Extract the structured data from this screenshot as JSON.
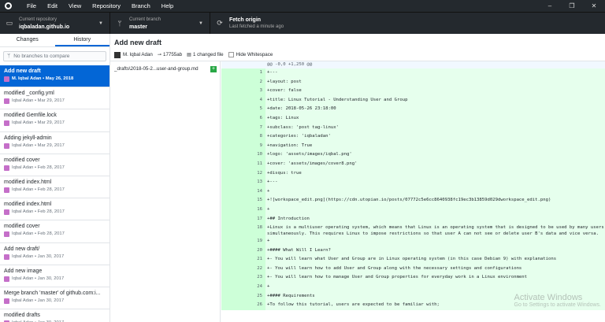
{
  "menu": [
    "File",
    "Edit",
    "View",
    "Repository",
    "Branch",
    "Help"
  ],
  "window_controls": [
    "–",
    "❐",
    "✕"
  ],
  "toolbar": {
    "repo_label": "Current repository",
    "repo_name": "iqbaladan.github.io",
    "branch_label": "Current branch",
    "branch_name": "master",
    "fetch_title": "Fetch origin",
    "fetch_sub": "Last fetched a minute ago"
  },
  "tabs": {
    "changes": "Changes",
    "history": "History"
  },
  "compare_placeholder": "No branches to compare",
  "commits": [
    {
      "summary": "Add new draft",
      "meta": "M. Iqbal Adan • May 26, 2018",
      "selected": true
    },
    {
      "summary": "modified _config.yml",
      "meta": "Iqbal Adan • Mar 29, 2017"
    },
    {
      "summary": "modified Gemfile.lock",
      "meta": "Iqbal Adan • Mar 29, 2017"
    },
    {
      "summary": "Adding jekyll-admin",
      "meta": "Iqbal Adan • Mar 29, 2017"
    },
    {
      "summary": "modified cover",
      "meta": "Iqbal Adan • Feb 28, 2017"
    },
    {
      "summary": "modified index.html",
      "meta": "Iqbal Adan • Feb 28, 2017"
    },
    {
      "summary": "modified index.html",
      "meta": "Iqbal Adan • Feb 28, 2017"
    },
    {
      "summary": "modified cover",
      "meta": "Iqbal Adan • Feb 28, 2017"
    },
    {
      "summary": "Add new draft/",
      "meta": "Iqbal Adan • Jan 30, 2017"
    },
    {
      "summary": "Add new image",
      "meta": "Iqbal Adan • Jan 30, 2017"
    },
    {
      "summary": "Merge branch 'master' of github.com:i...",
      "meta": "Iqbal Adan • Jan 30, 2017"
    },
    {
      "summary": "modified drafts",
      "meta": "Iqbal Adan • Jan 30, 2017"
    }
  ],
  "commit_detail": {
    "title": "Add new draft",
    "author": "M. Iqbal Adan",
    "sha": "17755ab",
    "files_changed": "1 changed file",
    "hide_whitespace": "Hide Whitespace"
  },
  "file": {
    "name": "_drafts\\2018-05-2...user-and-group.md",
    "status": "+"
  },
  "diff": {
    "hunk": "@@ -0,0 +1,250 @@",
    "lines": [
      {
        "n": "1",
        "code": "+---"
      },
      {
        "n": "2",
        "code": "+layout: post"
      },
      {
        "n": "3",
        "code": "+cover: false"
      },
      {
        "n": "4",
        "code": "+title: Linux Tutorial - Understanding User and Group"
      },
      {
        "n": "5",
        "code": "+date: 2018-05-26 23:18:00"
      },
      {
        "n": "6",
        "code": "+tags: Linux"
      },
      {
        "n": "7",
        "code": "+subclass: 'post tag-linux'"
      },
      {
        "n": "8",
        "code": "+categories: 'iqbaladan'"
      },
      {
        "n": "9",
        "code": "+navigation: True"
      },
      {
        "n": "10",
        "code": "+logo: 'assets/images/iqbal.png'"
      },
      {
        "n": "11",
        "code": "+cover: 'assets/images/cover8.png'"
      },
      {
        "n": "12",
        "code": "+disqus: true"
      },
      {
        "n": "13",
        "code": "+---"
      },
      {
        "n": "14",
        "code": "+"
      },
      {
        "n": "15",
        "code": "+![workspace_edit.png](https://cdn.utopian.io/posts/07772c5e6cc8640938fc19ec3b13859d029dworkspace_edit.png)"
      },
      {
        "n": "16",
        "code": "+"
      },
      {
        "n": "17",
        "code": "+## Introduction"
      },
      {
        "n": "18",
        "code": "+Linux is a multiuser operating system, which means that Linux is an operating system that is designed to be used by many users simultaneously. This requires Linux to impose restrictions so that user A can not see or delete user B's data and vice versa.",
        "tall": true
      },
      {
        "n": "19",
        "code": "+"
      },
      {
        "n": "20",
        "code": "+#### What Will I Learn?"
      },
      {
        "n": "21",
        "code": "+- You will learn what User and Group are in Linux operating system (in this case Debian 9) with explanations"
      },
      {
        "n": "22",
        "code": "+- You will learn how to add User and Group along with the necessary settings and configurations"
      },
      {
        "n": "23",
        "code": "+- You will learn how to manage User and Group properties for everyday work in a Linux environment"
      },
      {
        "n": "24",
        "code": "+"
      },
      {
        "n": "25",
        "code": "+#### Requirements"
      },
      {
        "n": "26",
        "code": "+To follow this tutorial, users are expected to be familiar with;"
      }
    ]
  },
  "watermark": {
    "line1": "Activate Windows",
    "line2": "Go to Settings to activate Windows."
  }
}
